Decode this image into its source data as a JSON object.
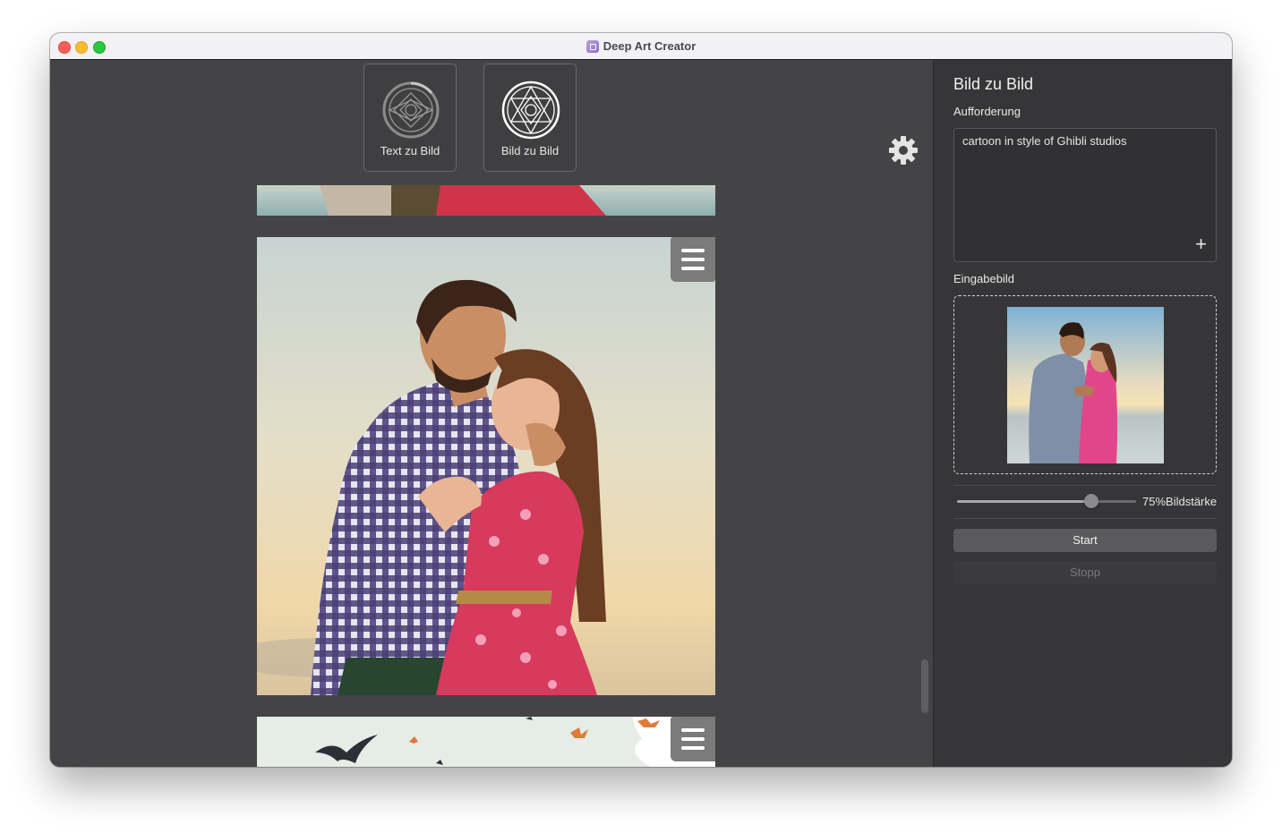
{
  "window": {
    "title": "Deep Art Creator"
  },
  "modes": [
    {
      "label": "Text zu Bild",
      "icon": "text-to-image-icon"
    },
    {
      "label": "Bild zu Bild",
      "icon": "image-to-image-icon"
    }
  ],
  "toolbar": {
    "settings_icon": "gear-icon"
  },
  "gallery": {
    "items": [
      {
        "name": "cartoon-couple-image",
        "menu_icon": "hamburger-menu-icon"
      },
      {
        "name": "cartoon-birds-image",
        "menu_icon": "hamburger-menu-icon"
      }
    ]
  },
  "sidebar": {
    "heading": "Bild zu Bild",
    "prompt_label": "Aufforderung",
    "prompt_value": "cartoon in style of Ghibli studios",
    "add_icon": "plus-icon",
    "input_image_label": "Eingabebild",
    "strength": {
      "value": 0.75,
      "display": "75%",
      "label": "Bildstärke"
    },
    "start_label": "Start",
    "stop_label": "Stopp"
  },
  "colors": {
    "main_bg": "#444446",
    "sidebar_bg": "#363638",
    "titlebar_bg": "#f2f1f3"
  }
}
